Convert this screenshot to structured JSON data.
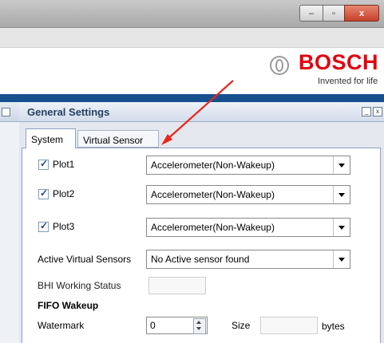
{
  "window": {
    "minimize_glyph": "–",
    "maximize_glyph": "▫",
    "close_glyph": "x"
  },
  "brand": {
    "name": "BOSCH",
    "tagline": "Invented for life",
    "color": "#e3000f",
    "logo_icon": "bosch-armature-icon"
  },
  "panel": {
    "title": "General Settings",
    "min_glyph": "_",
    "close_glyph": "x"
  },
  "tabs": [
    {
      "label": "System",
      "active": true
    },
    {
      "label": "Virtual Sensor",
      "active": false
    }
  ],
  "plots": [
    {
      "label": "Plot1",
      "checked": true,
      "value": "Accelerometer(Non-Wakeup)"
    },
    {
      "label": "Plot2",
      "checked": true,
      "value": "Accelerometer(Non-Wakeup)"
    },
    {
      "label": "Plot3",
      "checked": true,
      "value": "Accelerometer(Non-Wakeup)"
    }
  ],
  "active_sensors": {
    "label": "Active Virtual Sensors",
    "value": "No Active sensor found"
  },
  "bhi_status": {
    "label": "BHI Working Status",
    "value": ""
  },
  "fifo": {
    "heading": "FIFO Wakeup",
    "watermark_label": "Watermark",
    "watermark_value": "0",
    "size_label": "Size",
    "size_value": "",
    "size_unit": "bytes"
  },
  "annotation": {
    "color": "#e8261c",
    "icon": "red-arrow-annotation"
  }
}
